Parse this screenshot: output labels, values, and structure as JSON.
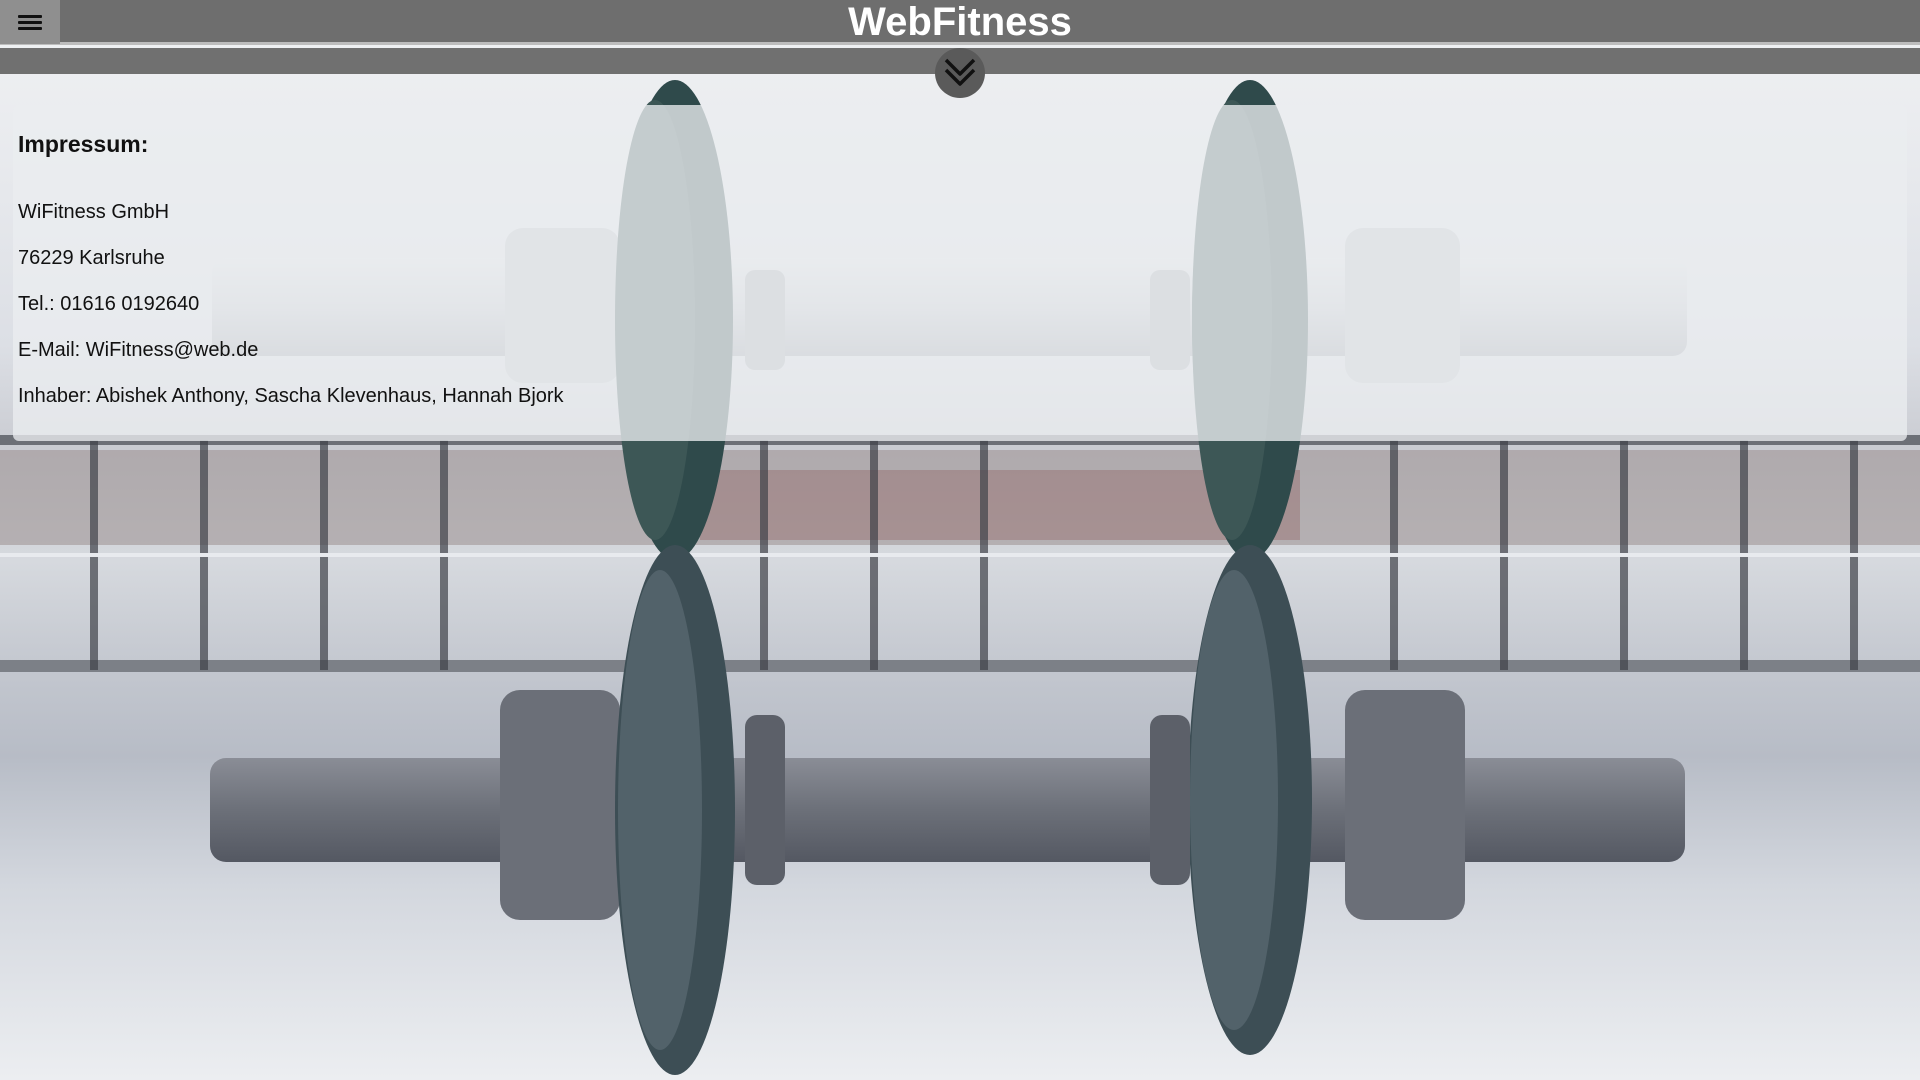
{
  "header": {
    "title": "WebFitness",
    "menu_icon": "hamburger-menu-icon",
    "scroll_icon": "double-chevron-down-icon"
  },
  "impressum": {
    "heading": "Impressum:",
    "lines": [
      "WiFitness GmbH",
      "76229 Karlsruhe",
      "Tel.: 01616 0192640",
      "E-Mail: WiFitness@web.de",
      "Inhaber: Abishek Anthony, Sascha Klevenhaus, Hannah Bjork"
    ]
  },
  "colors": {
    "topbar": "#6e6e6e",
    "menu_button": "#8f8f8f",
    "title_text": "#ffffff",
    "panel": "#ebedf0"
  }
}
